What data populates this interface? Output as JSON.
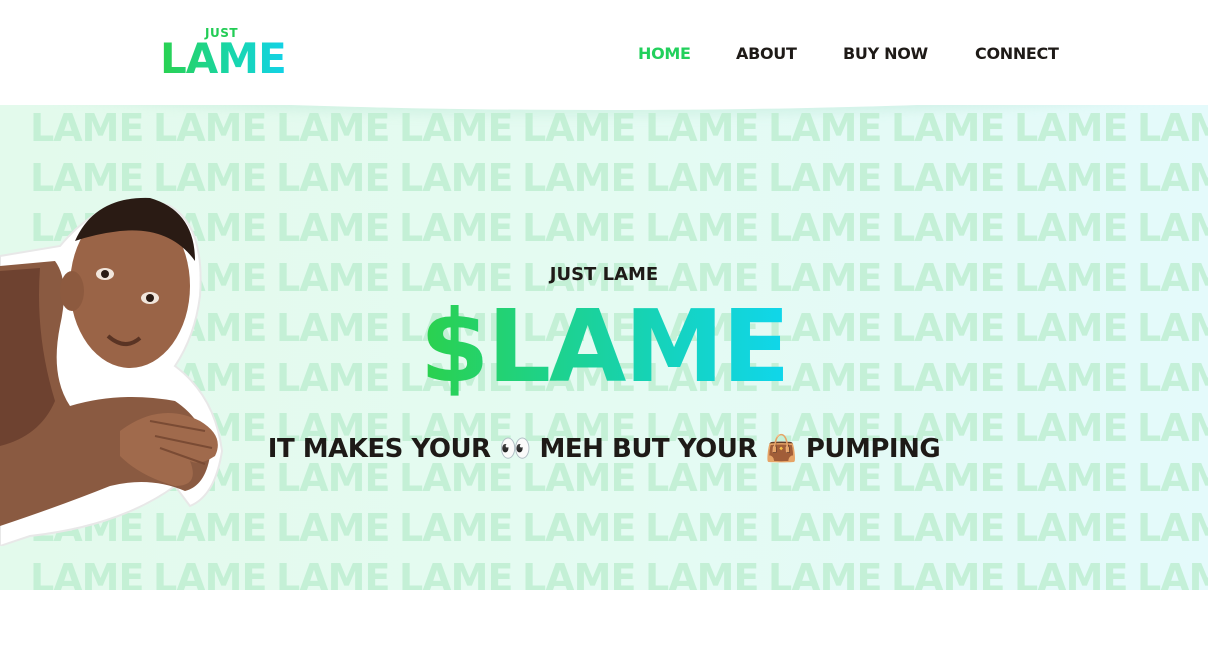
{
  "header": {
    "logo": {
      "small_text": "JUST",
      "word": "LAME"
    },
    "nav": [
      {
        "label": "HOME",
        "active": true
      },
      {
        "label": "ABOUT",
        "active": false
      },
      {
        "label": "BUY NOW",
        "active": false
      },
      {
        "label": "CONNECT",
        "active": false
      }
    ]
  },
  "hero": {
    "kicker": "JUST LAME",
    "ticker": "$LAME",
    "tagline": "IT MAKES YOUR 👀 MEH BUT YOUR 👜 PUMPING",
    "pattern_text": "LAME",
    "gradient_colors": [
      "#2bd14c",
      "#10d6ec"
    ]
  },
  "colors": {
    "nav_active": "#22d05c",
    "text_dark": "#1e1a17",
    "hero_bg": "#e4fbf1"
  }
}
